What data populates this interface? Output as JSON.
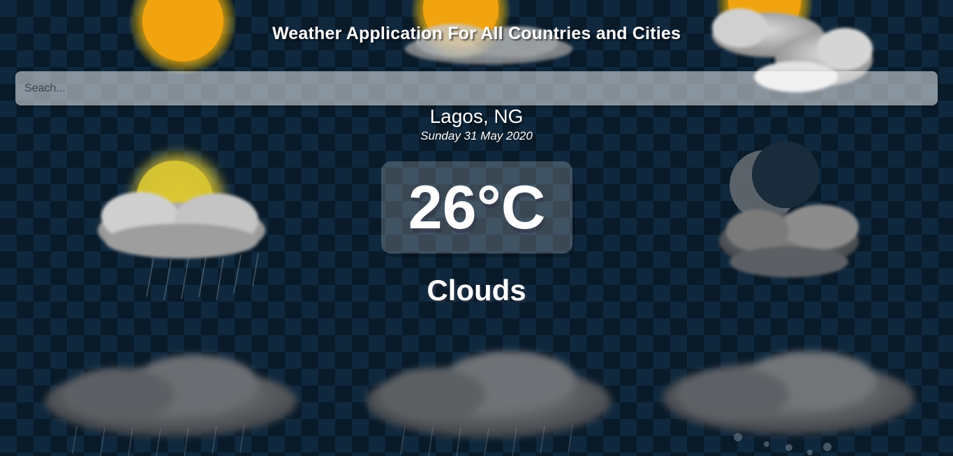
{
  "header": {
    "title": "Weather Application For All Countries and Cities"
  },
  "search": {
    "placeholder": "Seach...",
    "value": ""
  },
  "location": {
    "name": "Lagos, NG",
    "date": "Sunday 31 May 2020"
  },
  "weather": {
    "temperature": "26°C",
    "condition": "Clouds"
  },
  "background": {
    "icons": [
      "sun-icon",
      "sun-cloud-icon",
      "sun-cloud-icon",
      "sun-cloud-rain-icon",
      "moon-cloud-icon",
      "rain-cloud-icon",
      "rain-cloud-icon",
      "snow-cloud-icon"
    ]
  }
}
